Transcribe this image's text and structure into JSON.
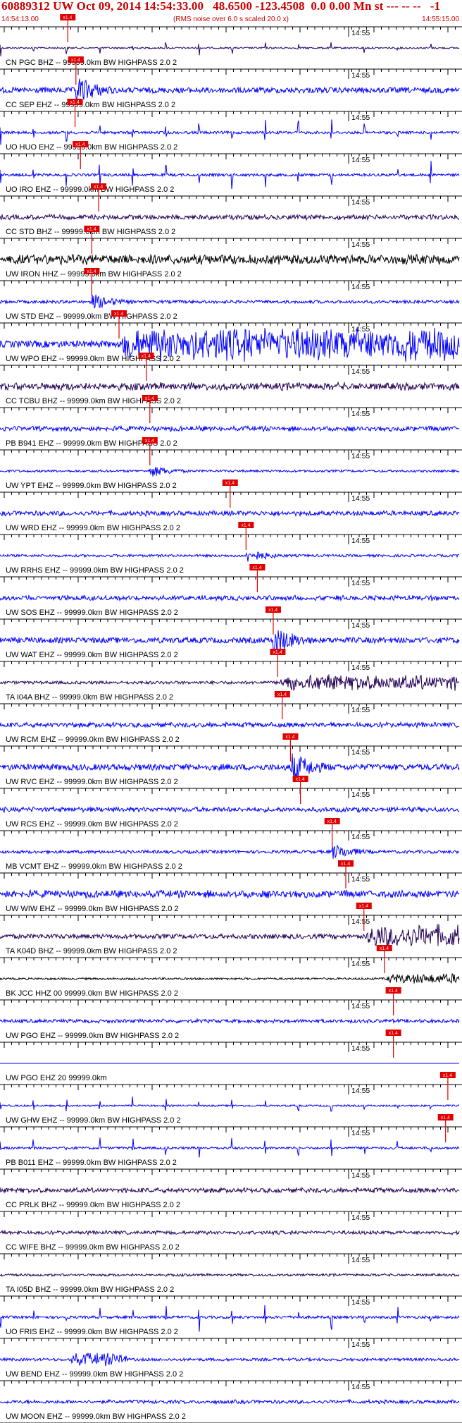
{
  "header": {
    "title": "60889312 UW Oct 09, 2014 14:54:33.00   48.6500 -123.4508  0.0 0.00 Mn st --- -- --   -1",
    "start_time": "14:54:13.00",
    "subtitle": "(RMS noise over 6.0 s scaled 20.0 x)",
    "end_time": "14:55:15.00"
  },
  "minute_label": "14:55",
  "pick_label": "x1.4",
  "colors": {
    "header_red": "#cc0000",
    "pick_red": "#e00000",
    "trace_blue": "#0000ff",
    "trace_purple": "#220055",
    "trace_black": "#000000"
  },
  "traces": [
    {
      "label": "CN PGC BHZ -- 99999.0km BW  HIGHPASS  2.0  2",
      "color": "#220066",
      "pick": 0.137,
      "style": "spikes",
      "amp": 10
    },
    {
      "label": "CC SEP EHZ -- 99999.0km BW  HIGHPASS  2.0  2",
      "color": "#0000ff",
      "pick": 0.155,
      "style": "burst",
      "amp": 22
    },
    {
      "label": "UO HUO EHZ -- 99999.0km BW  HIGHPASS  2.0  2",
      "color": "#0000ff",
      "pick": 0.153,
      "style": "spikes",
      "amp": 16
    },
    {
      "label": "UO IRO EHZ -- 99999.0km BW  HIGHPASS  2.0  2",
      "color": "#0000ff",
      "pick": 0.165,
      "style": "spikes",
      "amp": 16
    },
    {
      "label": "CC STD BHZ -- 99999.0km BW  HIGHPASS  2.0  2",
      "color": "#220055",
      "pick": 0.205,
      "style": "noise",
      "amp": 4
    },
    {
      "label": "UW IRON HHZ -- 99999.0km BW  HIGHPASS  2.0  2",
      "color": "#000000",
      "pick": 0.19,
      "style": "noise",
      "amp": 8
    },
    {
      "label": "UW STD EHZ -- 99999.0km BW  HIGHPASS  2.0  2",
      "color": "#0000ff",
      "pick": 0.19,
      "style": "burst",
      "amp": 12
    },
    {
      "label": "UW WPO EHZ -- 99999.0km BW  HIGHPASS  2.0  2",
      "color": "#0000ff",
      "pick": 0.25,
      "style": "sustain",
      "amp": 26
    },
    {
      "label": "CC TCBU BHZ -- 99999.0km BW  HIGHPASS  2.0  2",
      "color": "#220055",
      "pick": 0.31,
      "style": "noise",
      "amp": 6
    },
    {
      "label": "PB B941 EHZ -- 99999.0km BW  HIGHPASS  2.0  2",
      "color": "#0000ff",
      "pick": 0.318,
      "style": "noise",
      "amp": 4
    },
    {
      "label": "UW YPT EHZ -- 99999.0km BW  HIGHPASS  2.0  2",
      "color": "#0000ff",
      "pick": 0.318,
      "style": "burst",
      "amp": 9
    },
    {
      "label": "UW WRD EHZ -- 99999.0km BW  HIGHPASS  2.0  2",
      "color": "#0000ff",
      "pick": 0.495,
      "style": "noise",
      "amp": 4
    },
    {
      "label": "UW RRHS EHZ -- 99999.0km BW  HIGHPASS  2.0  2",
      "color": "#0000ff",
      "pick": 0.53,
      "style": "burst",
      "amp": 10
    },
    {
      "label": "UW SOS EHZ -- 99999.0km BW  HIGHPASS  2.0  2",
      "color": "#0000ff",
      "pick": 0.555,
      "style": "noise",
      "amp": 4
    },
    {
      "label": "UW WAT EHZ -- 99999.0km BW  HIGHPASS  2.0  2",
      "color": "#0000ff",
      "pick": 0.59,
      "style": "burst",
      "amp": 22
    },
    {
      "label": "TA I04A BHZ -- 99999.0km BW  HIGHPASS  2.0  2",
      "color": "#220055",
      "pick": 0.6,
      "style": "sustain",
      "amp": 12
    },
    {
      "label": "UW RCM EHZ -- 99999.0km BW  HIGHPASS  2.0  2",
      "color": "#0000ff",
      "pick": 0.61,
      "style": "noise",
      "amp": 4
    },
    {
      "label": "UW RVC EHZ -- 99999.0km BW  HIGHPASS  2.0  2",
      "color": "#0000ff",
      "pick": 0.628,
      "style": "burst",
      "amp": 24
    },
    {
      "label": "UW RCS EHZ -- 99999.0km BW  HIGHPASS  2.0  2",
      "color": "#0000ff",
      "pick": 0.65,
      "style": "noise",
      "amp": 4
    },
    {
      "label": "MB VCMT EHZ -- 99999.0km BW  HIGHPASS  2.0  2",
      "color": "#0000ff",
      "pick": 0.72,
      "style": "burst",
      "amp": 12
    },
    {
      "label": "UW WIW EHZ -- 99999.0km BW  HIGHPASS  2.0  2",
      "color": "#0000ff",
      "pick": 0.75,
      "style": "noise",
      "amp": 6
    },
    {
      "label": "TA K04D BHZ -- 99999.0km BW  HIGHPASS  2.0  2",
      "color": "#220055",
      "pick": 0.79,
      "style": "sustain",
      "amp": 18
    },
    {
      "label": "BK JCC HHZ 00 99999.0km BW  HIGHPASS  2.0  2",
      "color": "#000000",
      "pick": 0.835,
      "style": "sustain",
      "amp": 8
    },
    {
      "label": "UW PGO EHZ -- 99999.0km BW  HIGHPASS  2.0  2",
      "color": "#0000ff",
      "pick": 0.855,
      "style": "noise",
      "amp": 3
    },
    {
      "label": "UW PGO EHZ 20 99999.0km",
      "color": "#0000ff",
      "pick": 0.855,
      "style": "flat",
      "amp": 0
    },
    {
      "label": "UW GHW EHZ -- 99999.0km BW  HIGHPASS  2.0  2",
      "color": "#0000ff",
      "pick": 0.975,
      "style": "spikes",
      "amp": 10
    },
    {
      "label": "PB B011 EHZ -- 99999.0km BW  HIGHPASS  2.0  2",
      "color": "#0000ff",
      "pick": 0.97,
      "style": "spikes",
      "amp": 14
    },
    {
      "label": "CC PRLK BHZ -- 99999.0km BW  HIGHPASS  2.0  2",
      "color": "#220055",
      "pick": null,
      "style": "noise",
      "amp": 4
    },
    {
      "label": "CC WIFE BHZ -- 99999.0km BW  HIGHPASS  2.0  2",
      "color": "#220055",
      "pick": null,
      "style": "noise",
      "amp": 3
    },
    {
      "label": "TA I05D BHZ -- 99999.0km BW  HIGHPASS  2.0  2",
      "color": "#220055",
      "pick": null,
      "style": "noise",
      "amp": 2
    },
    {
      "label": "UO FRIS EHZ -- 99999.0km BW  HIGHPASS  2.0  2",
      "color": "#0000ff",
      "pick": null,
      "style": "spikes",
      "amp": 16
    },
    {
      "label": "UW BEND EHZ -- 99999.0km BW  HIGHPASS  2.0  2",
      "color": "#0000ff",
      "pick": null,
      "style": "burst2",
      "amp": 10
    },
    {
      "label": "UW MOON EHZ -- 99999.0km BW  HIGHPASS  2.0  2",
      "color": "#0000ff",
      "pick": null,
      "style": "noise",
      "amp": 3
    }
  ]
}
